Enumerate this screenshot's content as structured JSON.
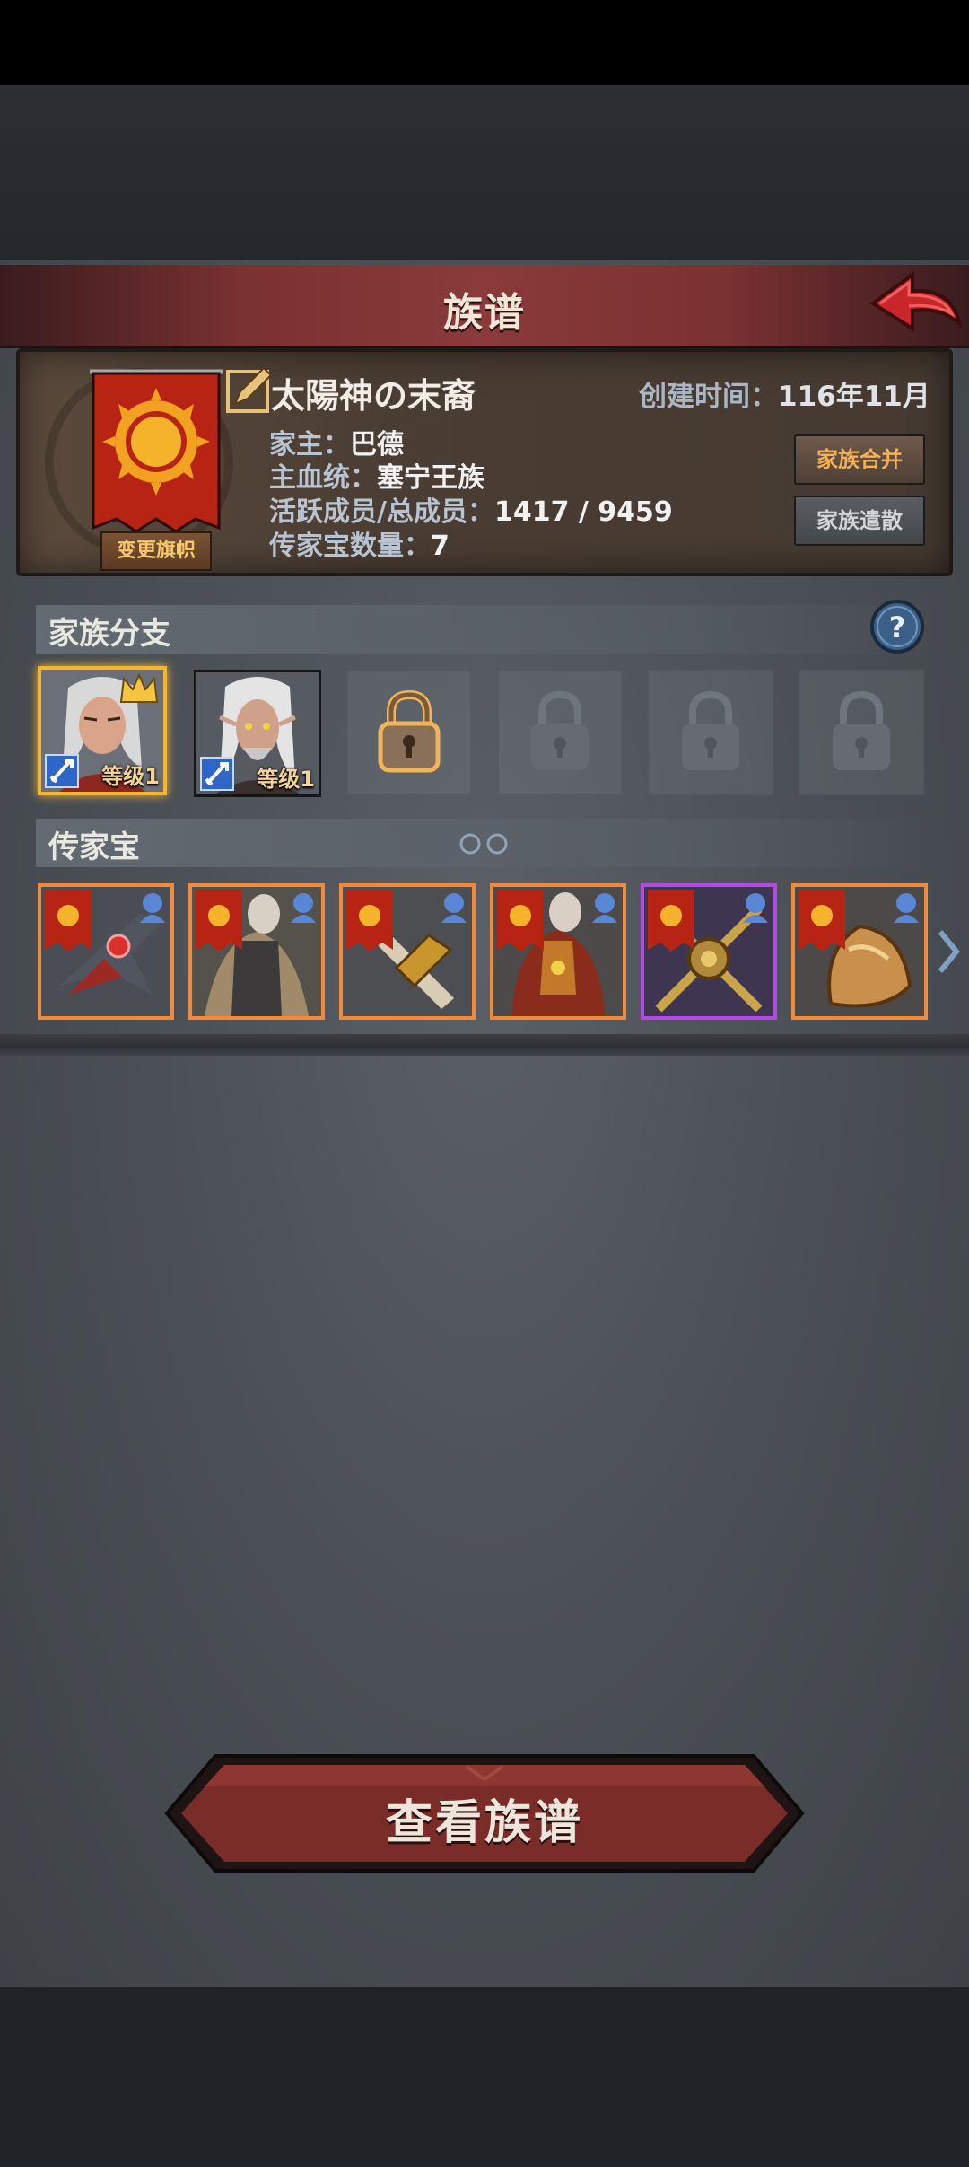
{
  "header": {
    "title": "族谱"
  },
  "family": {
    "change_flag_label": "变更旗帜",
    "name": "太陽神の末裔",
    "created_label": "创建时间：",
    "created_value": "116年11月",
    "head_label": "家主：",
    "head_value": "巴德",
    "bloodline_label": "主血统：",
    "bloodline_value": "塞宁王族",
    "members_label": "活跃成员/总成员：",
    "members_value": "1417 / 9459",
    "heirloom_count_label": "传家宝数量：",
    "heirloom_count_value": "7",
    "merge_label": "家族合并",
    "disband_label": "家族遣散"
  },
  "branches": {
    "title": "家族分支",
    "slots": [
      {
        "level_label": "等级1",
        "selected": true,
        "crown": true
      },
      {
        "level_label": "等级1",
        "selected": false,
        "crown": false
      }
    ]
  },
  "heirlooms": {
    "title": "传家宝"
  },
  "view_button_label": "查看族谱",
  "colors": {
    "accent_red": "#8a3a3a",
    "highlight_gold": "#f3b62e",
    "item_orange": "#f08a3c",
    "item_purple": "#b34ae4"
  }
}
